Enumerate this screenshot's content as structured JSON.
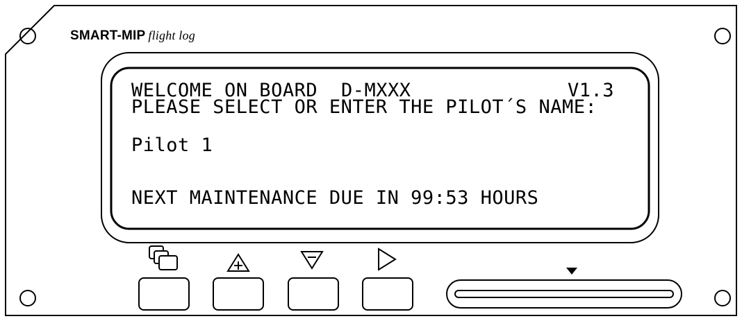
{
  "brand": {
    "name": "SMART-MIP",
    "subtitle": "flight log"
  },
  "display": {
    "line1_left": "WELCOME ON BOARD",
    "line1_reg": "D-MXXX",
    "line1_version": "V1.3",
    "line2": "PLEASE SELECT OR ENTER THE PILOT´S NAME:",
    "pilot_entry": "Pilot 1",
    "maintenance": "NEXT MAINTENANCE DUE IN 99:53 HOURS"
  },
  "buttons": [
    {
      "icon": "menu-pages-icon"
    },
    {
      "icon": "up-arrow-icon"
    },
    {
      "icon": "down-arrow-icon"
    },
    {
      "icon": "play-right-icon"
    }
  ],
  "card_slot": {
    "indicator": "slot-insert-arrow-icon"
  },
  "colors": {
    "ink": "#000000",
    "background": "#ffffff"
  }
}
